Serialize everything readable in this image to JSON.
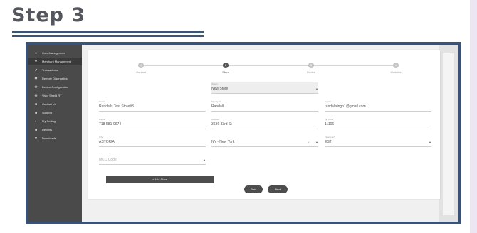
{
  "heading": "Step 3",
  "sidebar": {
    "items": [
      {
        "label": "User Management",
        "icon": "user-icon",
        "glyph": "●"
      },
      {
        "label": "Merchant Management",
        "icon": "store-icon",
        "glyph": "▼",
        "active": true
      },
      {
        "label": "Transactions",
        "icon": "chart-icon",
        "glyph": "↗"
      },
      {
        "label": "Remote Diagnostics",
        "icon": "diagnostics-icon",
        "glyph": "✱"
      },
      {
        "label": "Device Configuration",
        "icon": "device-icon",
        "glyph": "⚙"
      },
      {
        "label": "Valor Shield RT",
        "icon": "shield-icon",
        "glyph": "◈"
      },
      {
        "label": "Contact Us",
        "icon": "contact-icon",
        "glyph": "■"
      },
      {
        "label": "Support",
        "icon": "support-icon",
        "glyph": "■"
      },
      {
        "label": "My Setting",
        "icon": "setting-icon",
        "glyph": "◐"
      },
      {
        "label": "Reports",
        "icon": "report-icon",
        "glyph": "■"
      },
      {
        "label": "Downloads",
        "icon": "download-icon",
        "glyph": "▼"
      }
    ]
  },
  "stepper": {
    "steps": [
      {
        "num": "1",
        "label": "Contact"
      },
      {
        "num": "2",
        "label": "Store",
        "current": true
      },
      {
        "num": "3",
        "label": "Device"
      },
      {
        "num": "4",
        "label": "Modules"
      }
    ]
  },
  "form": {
    "store_select": {
      "label": "Stores",
      "value": "New Store"
    },
    "store_name": {
      "label": "Store*",
      "value": "Randalls Test Store#3"
    },
    "manager": {
      "label": "Manager*",
      "value": "Randall"
    },
    "email": {
      "label": "Email*",
      "value": "randallsingh1@gmail.com"
    },
    "phone": {
      "label": "Phone*",
      "value": "718-581-9674"
    },
    "address": {
      "label": "Address*",
      "value": "3636 33rd St"
    },
    "zip": {
      "label": "Zip Code*",
      "value": "11106"
    },
    "city": {
      "label": "City*",
      "value": "ASTORIA"
    },
    "state": {
      "label": "",
      "value": "NY - New York"
    },
    "timezone": {
      "label": "Timezone*",
      "value": "EST"
    },
    "mcc": {
      "label": "",
      "placeholder": "MCC Code"
    }
  },
  "buttons": {
    "add_store": "+ Add Store",
    "prev": "Prev",
    "next": "Next"
  }
}
